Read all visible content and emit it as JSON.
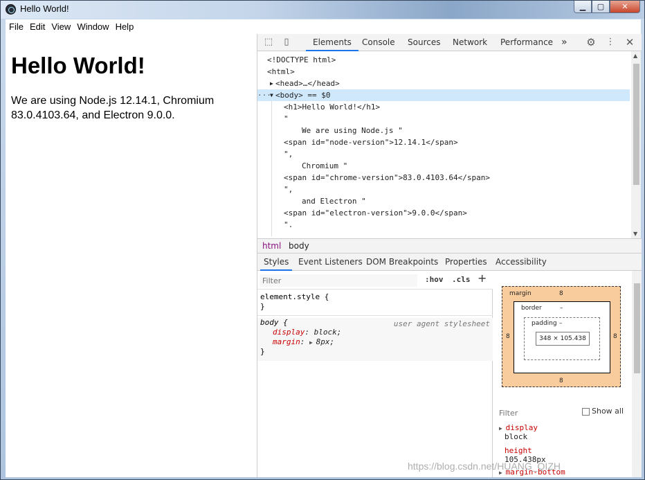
{
  "window": {
    "title": "Hello World!"
  },
  "menu": [
    "File",
    "Edit",
    "View",
    "Window",
    "Help"
  ],
  "page": {
    "heading": "Hello World!",
    "paragraph": "We are using Node.js 12.14.1, Chromium 83.0.4103.64, and Electron 9.0.0."
  },
  "devtools": {
    "tabs": [
      "Elements",
      "Console",
      "Sources",
      "Network",
      "Performance"
    ],
    "more_tabs": "»",
    "code_lines": [
      {
        "text": "<!DOCTYPE html>"
      },
      {
        "text": "<html>"
      },
      {
        "text": "<head>…</head>"
      },
      {
        "text": "<body> == $0"
      },
      {
        "text": "<h1>Hello World!</h1>"
      },
      {
        "text": "\""
      },
      {
        "text": "We are using Node.js \""
      },
      {
        "text": "<span id=\"node-version\">12.14.1</span>"
      },
      {
        "text": "\","
      },
      {
        "text": "Chromium \""
      },
      {
        "text": "<span id=\"chrome-version\">83.0.4103.64</span>"
      },
      {
        "text": "\","
      },
      {
        "text": "and Electron \""
      },
      {
        "text": "<span id=\"electron-version\">9.0.0</span>"
      },
      {
        "text": "\"."
      }
    ],
    "breadcrumb": [
      "html",
      "body"
    ],
    "sub_tabs": [
      "Styles",
      "Event Listeners",
      "DOM Breakpoints",
      "Properties",
      "Accessibility"
    ],
    "styles": {
      "filter_placeholder": "Filter",
      "hov": ":hov",
      "cls": ".cls",
      "plus": "+",
      "element_style_open": "element.style {",
      "element_style_close": "}",
      "body_selector": "body {",
      "user_agent": "user agent stylesheet",
      "display_prop": "display",
      "display_val": "block;",
      "margin_prop": "margin",
      "margin_val": "8px;",
      "body_close": "}"
    },
    "box_model": {
      "margin_label": "margin",
      "margin_top": "8",
      "margin_bottom": "8",
      "margin_left": "8",
      "margin_right": "8",
      "border_label": "border",
      "border_dash": "–",
      "padding_label": "padding",
      "padding_dash": "–",
      "content": "348 × 105.438"
    },
    "computed": {
      "filter_placeholder": "Filter",
      "show_all": "Show all",
      "rows": [
        {
          "name": "display",
          "value": "block"
        },
        {
          "name": "height",
          "value": "105.438px"
        },
        {
          "name": "margin-bottom",
          "value": ""
        }
      ]
    }
  },
  "watermark": "https://blog.csdn.net/HUANG_QIZH"
}
